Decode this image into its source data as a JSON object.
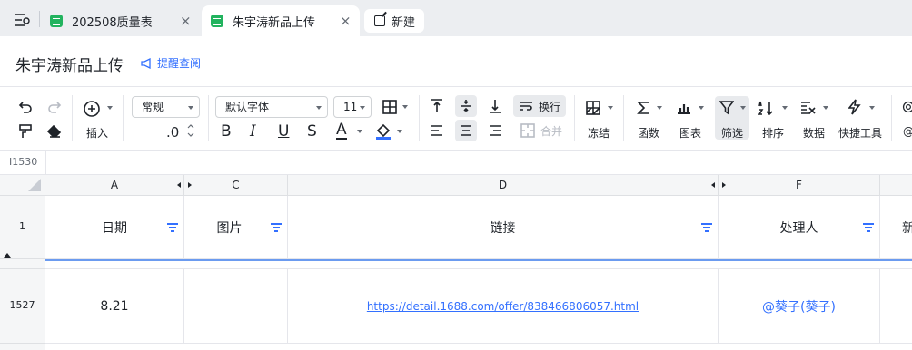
{
  "tabs": [
    {
      "label": "202508质量表",
      "active": false
    },
    {
      "label": "朱宇涛新品上传",
      "active": true
    }
  ],
  "new_tab_label": "新建",
  "close_glyph": "×",
  "doc": {
    "title": "朱宇涛新品上传",
    "remind_label": "提醒查阅"
  },
  "toolbar": {
    "insert_label": "插入",
    "format_value": "常规",
    "decimal_label": ".0",
    "font_value": "默认字体",
    "font_size_value": "11",
    "bold": "B",
    "italic": "I",
    "underline": "U",
    "strike": "S",
    "text_color": "A",
    "wrap_label": "换行",
    "merge_label": "合并",
    "freeze_label": "冻结",
    "function_label": "函数",
    "chart_label": "图表",
    "filter_label": "筛选",
    "sort_label": "排序",
    "data_label": "数据",
    "quicktools_label": "快捷工具",
    "at_label": "@"
  },
  "formula_bar": {
    "cell_ref": "I1530"
  },
  "grid": {
    "columns": [
      "A",
      "C",
      "D",
      "F"
    ],
    "header_row": {
      "row_number": "1",
      "cells": [
        "日期",
        "图片",
        "链接",
        "处理人",
        "新"
      ]
    },
    "rows": [
      {
        "row_number": "1527",
        "date": "8.21",
        "image": "",
        "link": "https://detail.1688.com/offer/838466806057.html",
        "handler": "@葵子(葵子)"
      }
    ]
  },
  "colors": {
    "accent": "#3370ff",
    "sheet_icon": "#22b35e",
    "freeze_line": "#6b9bf0"
  }
}
